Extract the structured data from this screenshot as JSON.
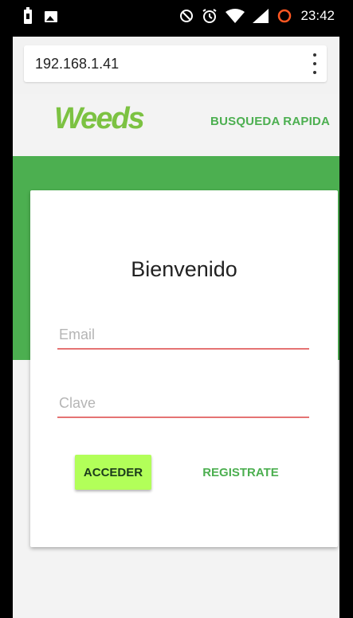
{
  "status_bar": {
    "time": "23:42",
    "left_icons": [
      "battery-saver-icon",
      "image-notification-icon"
    ],
    "right_icons": [
      "do-not-disturb-icon",
      "alarm-icon",
      "wifi-icon",
      "signal-icon",
      "battery-ring-icon"
    ]
  },
  "browser": {
    "url": "192.168.1.41",
    "menu_icon": "more-vert-icon"
  },
  "header": {
    "logo": "Weeds",
    "quick_search": "BUSQUEDA RAPIDA"
  },
  "login": {
    "title": "Bienvenido",
    "email_placeholder": "Email",
    "password_placeholder": "Clave",
    "login_button": "ACCEDER",
    "register_button": "REGISTRATE"
  },
  "colors": {
    "primary": "#4caf50",
    "accent": "#b2ff59",
    "logo": "#7cc242",
    "error_underline": "#e57373"
  }
}
